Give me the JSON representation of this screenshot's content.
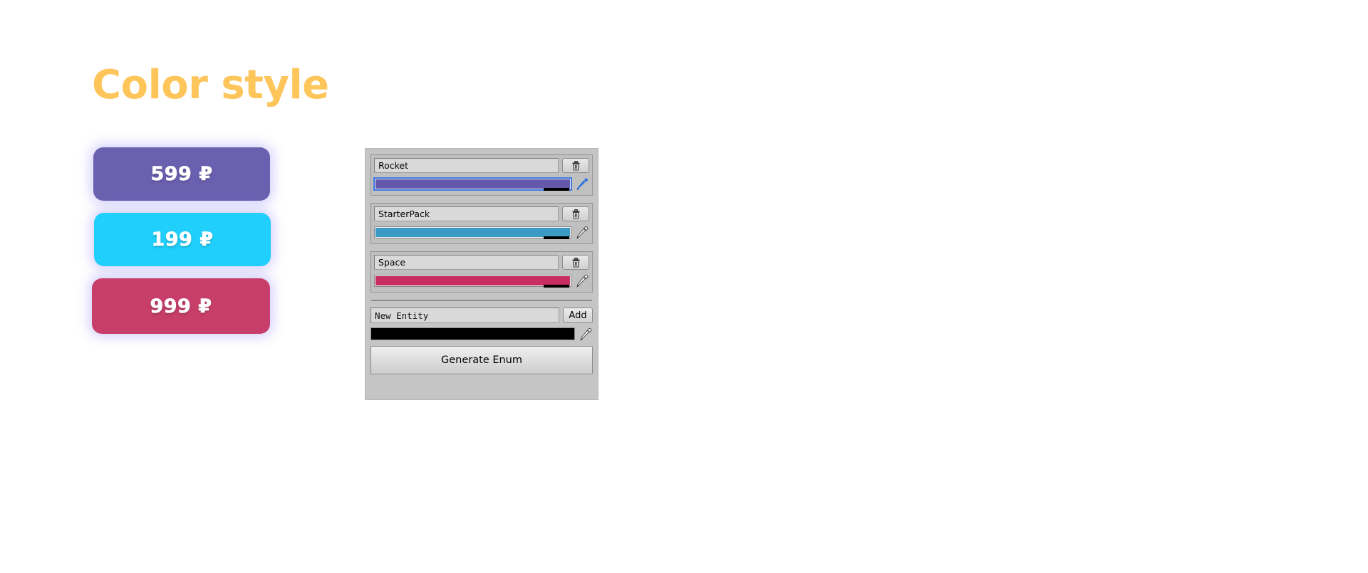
{
  "showcase": {
    "title": "Color style",
    "title_color": "#FDC55A",
    "buttons": [
      {
        "label": "599 ₽",
        "color": "#6B60B0",
        "name": "price-button-599"
      },
      {
        "label": "199 ₽",
        "color": "#20CFFB",
        "name": "price-button-199"
      },
      {
        "label": "999 ₽",
        "color": "#C63E69",
        "name": "price-button-999"
      }
    ]
  },
  "editor": {
    "panel_background": "#c5c5c5",
    "entities": [
      {
        "name": "Rocket",
        "color": "#6458AC",
        "delete_icon": "trash-icon",
        "picker_icon": "eyedropper-icon",
        "picker_active": true
      },
      {
        "name": "StarterPack",
        "color": "#3B9BC4",
        "delete_icon": "trash-icon",
        "picker_icon": "eyedropper-icon",
        "picker_active": false
      },
      {
        "name": "Space",
        "color": "#C62F5F",
        "delete_icon": "trash-icon",
        "picker_icon": "eyedropper-icon",
        "picker_active": false
      }
    ],
    "new_entity": {
      "value": "New Entity",
      "placeholder": "New Entity",
      "add_label": "Add",
      "color": "#000000",
      "picker_icon": "eyedropper-icon"
    },
    "generate_label": "Generate Enum"
  }
}
